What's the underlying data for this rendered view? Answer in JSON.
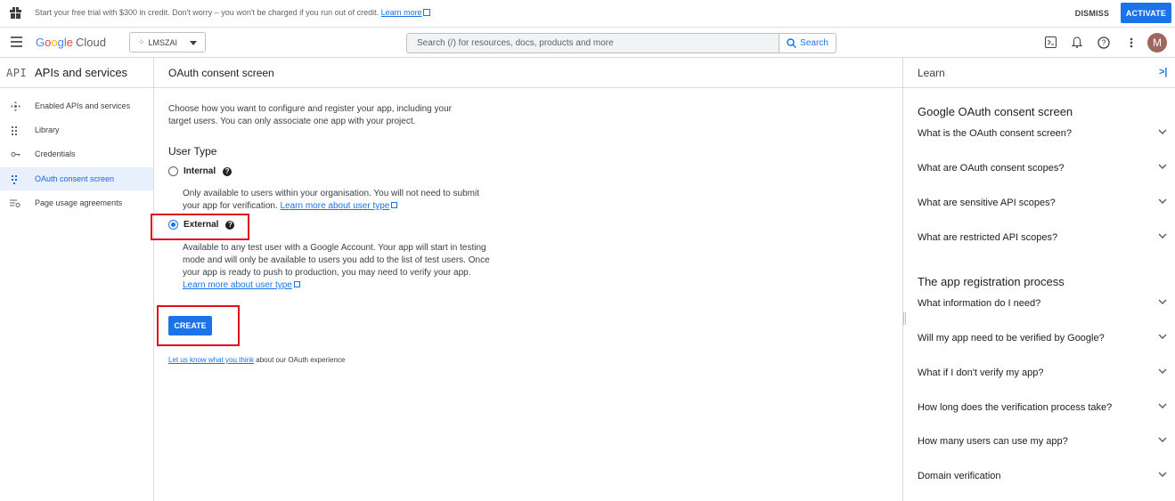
{
  "banner": {
    "message": "Start your free trial with $300 in credit. Don't worry – you won't be charged if you run out of credit.",
    "learn_more": "Learn more",
    "dismiss": "DISMISS",
    "activate": "ACTIVATE"
  },
  "header": {
    "logo_google": [
      "G",
      "o",
      "o",
      "g",
      "l",
      "e"
    ],
    "logo_cloud": "Cloud",
    "project": "LMSZAI",
    "search_placeholder": "Search (/) for resources, docs, products and more",
    "search_button": "Search",
    "avatar_initial": "M"
  },
  "leftnav": {
    "logo": "API",
    "title": "APIs and services",
    "items": [
      {
        "label": "Enabled APIs and services",
        "icon": "enabled-apis-icon"
      },
      {
        "label": "Library",
        "icon": "library-icon"
      },
      {
        "label": "Credentials",
        "icon": "key-icon"
      },
      {
        "label": "OAuth consent screen",
        "icon": "oauth-icon",
        "active": true
      },
      {
        "label": "Page usage agreements",
        "icon": "settings-list-icon"
      }
    ]
  },
  "main": {
    "title": "OAuth consent screen",
    "intro": "Choose how you want to configure and register your app, including your target users. You can only associate one app with your project.",
    "user_type_title": "User Type",
    "internal": {
      "label": "Internal",
      "description": "Only available to users within your organisation. You will not need to submit your app for verification.",
      "link": "Learn more about user type"
    },
    "external": {
      "label": "External",
      "description": "Available to any test user with a Google Account. Your app will start in testing mode and will only be available to users you add to the list of test users. Once your app is ready to push to production, you may need to verify your app.",
      "link": "Learn more about user type"
    },
    "selected": "External",
    "create_button": "CREATE",
    "feedback_link": "Let us know what you think",
    "feedback_text": " about our OAuth experience"
  },
  "learn": {
    "title": "Learn",
    "collapse": ">|",
    "section1": "Google OAuth consent screen",
    "faq1": [
      "What is the OAuth consent screen?",
      "What are OAuth consent scopes?",
      "What are sensitive API scopes?",
      "What are restricted API scopes?"
    ],
    "section2": "The app registration process",
    "faq2": [
      "What information do I need?",
      "Will my app need to be verified by Google?",
      "What if I don't verify my app?",
      "How long does the verification process take?",
      "How many users can use my app?",
      "Domain verification"
    ]
  },
  "colors": {
    "primary": "#1a73e8",
    "highlight": "#e0101a",
    "active_bg": "#e8f0fe"
  }
}
